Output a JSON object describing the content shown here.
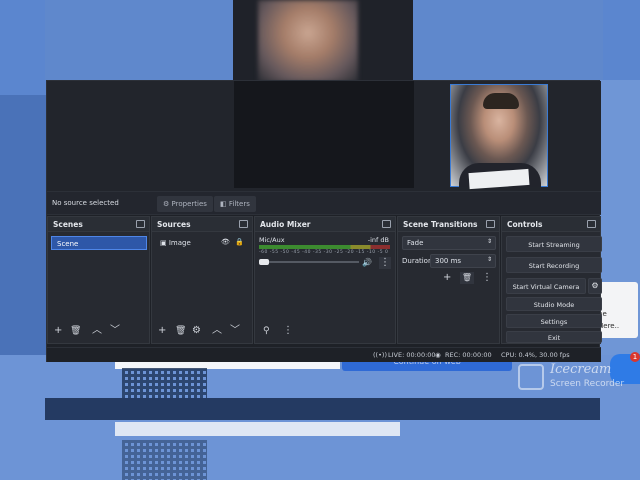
{
  "background": {
    "web_button": "Continue on web",
    "popup_text": [
      "be",
      "Here.."
    ],
    "chat_badge": "1",
    "watermark_name": "Icecream",
    "watermark_sub": "Screen Recorder"
  },
  "toolbar": {
    "no_source": "No source selected",
    "properties": "Properties",
    "filters": "Filters"
  },
  "scenes": {
    "title": "Scenes",
    "items": [
      "Scene"
    ]
  },
  "sources": {
    "title": "Sources",
    "items": [
      "Image"
    ]
  },
  "audio_mixer": {
    "title": "Audio Mixer",
    "channel": "Mic/Aux",
    "level": "-inf dB",
    "scale": "-60 -55 -50 -45 -40 -35 -30 -25 -20 -15 -10 -5 0"
  },
  "scene_transitions": {
    "title": "Scene Transitions",
    "transition": "Fade",
    "duration_label": "Duration",
    "duration_value": "300 ms"
  },
  "controls": {
    "title": "Controls",
    "start_streaming": "Start Streaming",
    "start_recording": "Start Recording",
    "start_virtual_camera": "Start Virtual Camera",
    "studio_mode": "Studio Mode",
    "settings": "Settings",
    "exit": "Exit"
  },
  "status": {
    "live": "LIVE: 00:00:00",
    "rec": "REC: 00:00:00",
    "cpu": "CPU: 0.4%, 30.00 fps"
  },
  "colors": {
    "accent": "#2e57a8",
    "window_bg": "#1e2127",
    "dock_bg": "#272a31"
  }
}
